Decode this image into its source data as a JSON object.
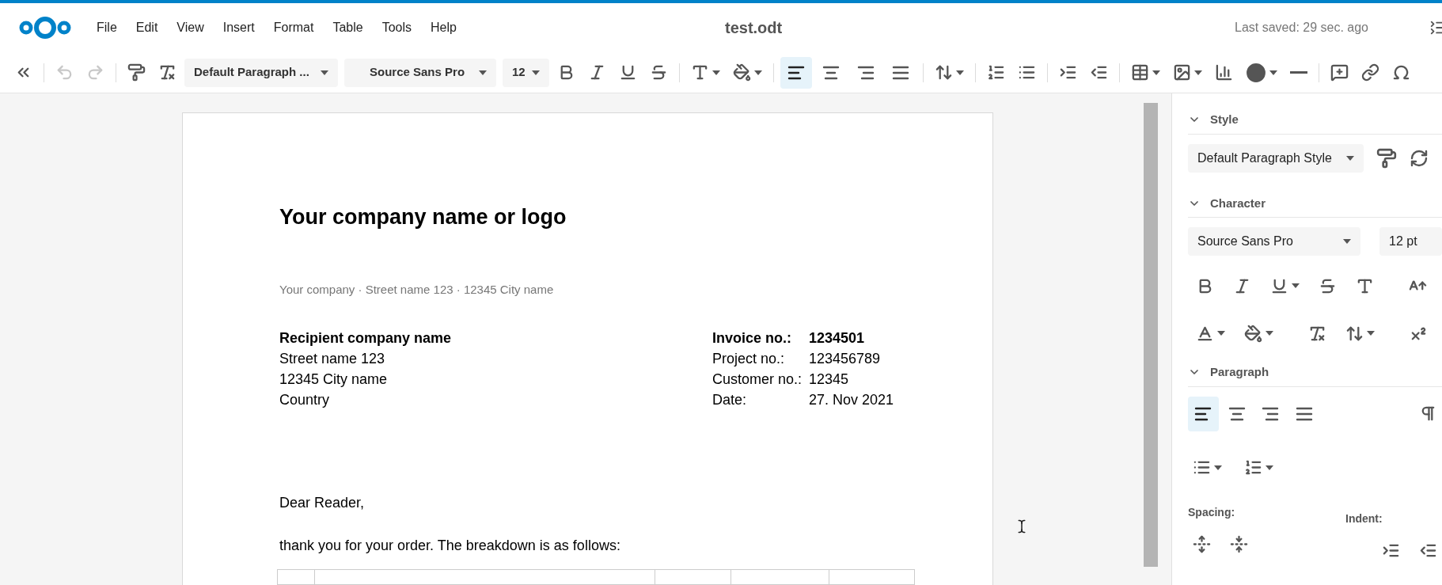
{
  "header": {
    "menu": [
      "File",
      "Edit",
      "View",
      "Insert",
      "Format",
      "Table",
      "Tools",
      "Help"
    ],
    "title": "test.odt",
    "last_saved": "Last saved: 29 sec. ago"
  },
  "toolbar": {
    "paragraph_style": "Default Paragraph ...",
    "font": "Source Sans Pro",
    "size": "12",
    "alignment": [
      {
        "kind": "left",
        "selected": true
      },
      {
        "kind": "center",
        "selected": false
      },
      {
        "kind": "right",
        "selected": false
      },
      {
        "kind": "justify",
        "selected": false
      }
    ]
  },
  "document": {
    "heading": "Your company name or logo",
    "sender_line": "Your company · Street name 123 · 12345 City name",
    "recipient": [
      {
        "text": "Recipient company name",
        "bold": true
      },
      {
        "text": "Street name 123",
        "bold": false
      },
      {
        "text": "12345 City name",
        "bold": false
      },
      {
        "text": "Country",
        "bold": false
      }
    ],
    "invoice_fields": [
      {
        "label": "Invoice no.:",
        "value": "1234501",
        "bold": true
      },
      {
        "label": "Project no.:",
        "value": "123456789",
        "bold": false
      },
      {
        "label": "Customer no.:",
        "value": "12345",
        "bold": false
      },
      {
        "label": "Date:",
        "value": "27. Nov 2021",
        "bold": false
      }
    ],
    "greeting": "Dear Reader,",
    "intro": "thank you for your order. The breakdown is as follows:"
  },
  "sidebar": {
    "sections": [
      {
        "kind": "style",
        "title": "Style",
        "expanded": true,
        "style_value": "Default Paragraph Style"
      },
      {
        "kind": "character",
        "title": "Character",
        "expanded": true,
        "font": "Source Sans Pro",
        "size": "12 pt"
      },
      {
        "kind": "paragraph",
        "title": "Paragraph",
        "expanded": true,
        "alignment": [
          {
            "kind": "left",
            "selected": true
          },
          {
            "kind": "center",
            "selected": false
          },
          {
            "kind": "right",
            "selected": false
          },
          {
            "kind": "justify",
            "selected": false
          }
        ],
        "spacing_label": "Spacing:",
        "indent_label": "Indent:"
      }
    ]
  }
}
